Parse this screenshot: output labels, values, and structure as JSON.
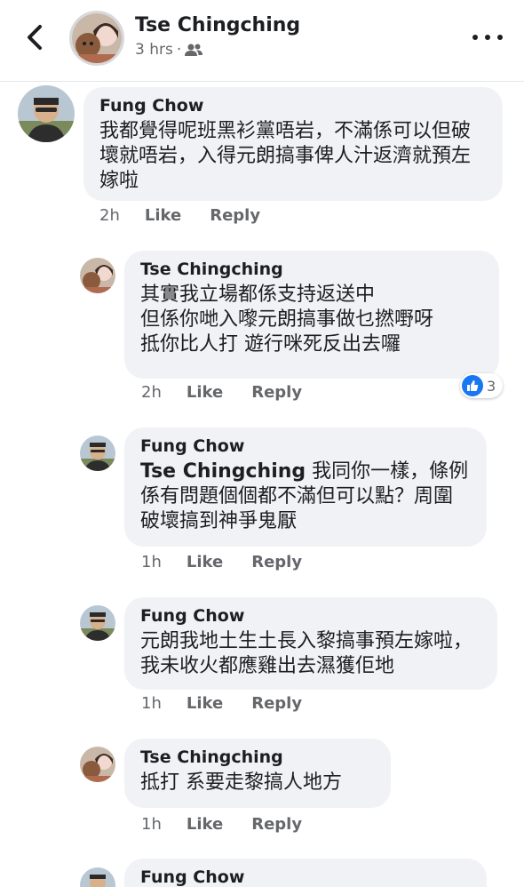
{
  "header": {
    "name": "Tse Chingching",
    "time": "3 hrs",
    "separator": "·",
    "audience_icon": "friends-icon"
  },
  "comments": [
    {
      "author": "Fung Chow",
      "text": "我都覺得呢班黑衫黨唔岩，不滿係可以但破壞就唔岩，入得元朗搞事俾人汁返濟就預左嫁啦",
      "time": "2h",
      "like": "Like",
      "reply": "Reply"
    },
    {
      "author": "Tse Chingching",
      "text": "其實我立場都係支持返送中\n但係你哋入嚟元朗搞事做乜撚嘢呀\n抵你比人打 遊行咪死反出去囉",
      "time": "2h",
      "like": "Like",
      "reply": "Reply",
      "reaction_count": "3"
    },
    {
      "author": "Fung Chow",
      "mention": "Tse Chingching",
      "text": " 我同你一樣，條例係有問題個個都不滿但可以點？周圍破壞搞到神爭鬼厭",
      "time": "1h",
      "like": "Like",
      "reply": "Reply"
    },
    {
      "author": "Fung Chow",
      "text": "元朗我地土生土長入黎搞事預左嫁啦，我未收火都應雞出去濕獲佢地",
      "time": "1h",
      "like": "Like",
      "reply": "Reply"
    },
    {
      "author": "Tse Chingching",
      "text": "抵打 系要走黎搞人地方",
      "time": "1h",
      "like": "Like",
      "reply": "Reply"
    },
    {
      "author": "Fung Chow"
    }
  ],
  "colors": {
    "bubble": "#f0f2f5",
    "meta_text": "#65676b",
    "like_blue": "#1877f2"
  }
}
